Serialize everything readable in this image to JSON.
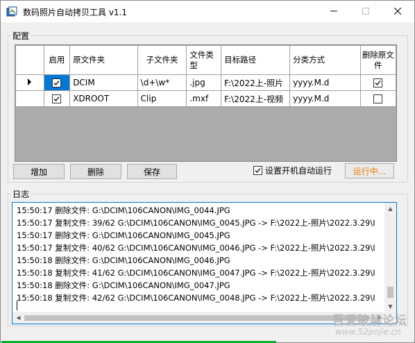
{
  "window": {
    "title": "数码照片自动拷贝工具 v1.1"
  },
  "config": {
    "group_label": "配置",
    "columns": [
      "启用",
      "原文件夹",
      "子文件夹",
      "文件类型",
      "目标路径",
      "分类方式",
      "删除原文件"
    ],
    "rows": [
      {
        "enabled": true,
        "source": "DCIM",
        "subfolder": "\\d+\\w*",
        "filetype": ".jpg",
        "target": "F:\\2022上-照片",
        "classify": "yyyy.M.d",
        "delete": true,
        "selected": true
      },
      {
        "enabled": true,
        "source": "XDROOT",
        "subfolder": "Clip",
        "filetype": ".mxf",
        "target": "F:\\2022上-视频",
        "classify": "yyyy.M.d",
        "delete": false,
        "selected": false
      }
    ]
  },
  "buttons": {
    "add": "增加",
    "delete": "删除",
    "save": "保存",
    "run": "运行中..."
  },
  "autostart": {
    "label": "设置开机自动运行",
    "checked": true
  },
  "log": {
    "group_label": "日志",
    "lines": [
      "15:50:17 删除文件: G:\\DCIM\\106CANON\\IMG_0044.JPG",
      "15:50:17 复制文件: 39/62 G:\\DCIM\\106CANON\\IMG_0045.JPG -> F:\\2022上-照片\\2022.3.29\\I",
      "15:50:17 删除文件: G:\\DCIM\\106CANON\\IMG_0045.JPG",
      "15:50:17 复制文件: 40/62 G:\\DCIM\\106CANON\\IMG_0046.JPG -> F:\\2022上-照片\\2022.3.29\\I",
      "15:50:18 删除文件: G:\\DCIM\\106CANON\\IMG_0046.JPG",
      "15:50:18 复制文件: 41/62 G:\\DCIM\\106CANON\\IMG_0047.JPG -> F:\\2022上-照片\\2022.3.29\\I",
      "15:50:18 删除文件: G:\\DCIM\\106CANON\\IMG_0047.JPG",
      "15:50:18 复制文件: 42/62 G:\\DCIM\\106CANON\\IMG_0048.JPG -> F:\\2022上-照片\\2022.3.29\\I"
    ]
  },
  "watermark": {
    "line1": "吾爱破解论坛",
    "line2": "www.52pojie.cn"
  },
  "colors": {
    "selection": "#0078d7",
    "run_text": "#e67e00",
    "progress": "#06b025"
  },
  "icons": {
    "app": "app-icon",
    "minimize": "minimize-icon",
    "maximize": "maximize-icon",
    "close": "close-icon",
    "row_pointer": "row-pointer-icon",
    "checkbox": "checkbox-icon"
  }
}
